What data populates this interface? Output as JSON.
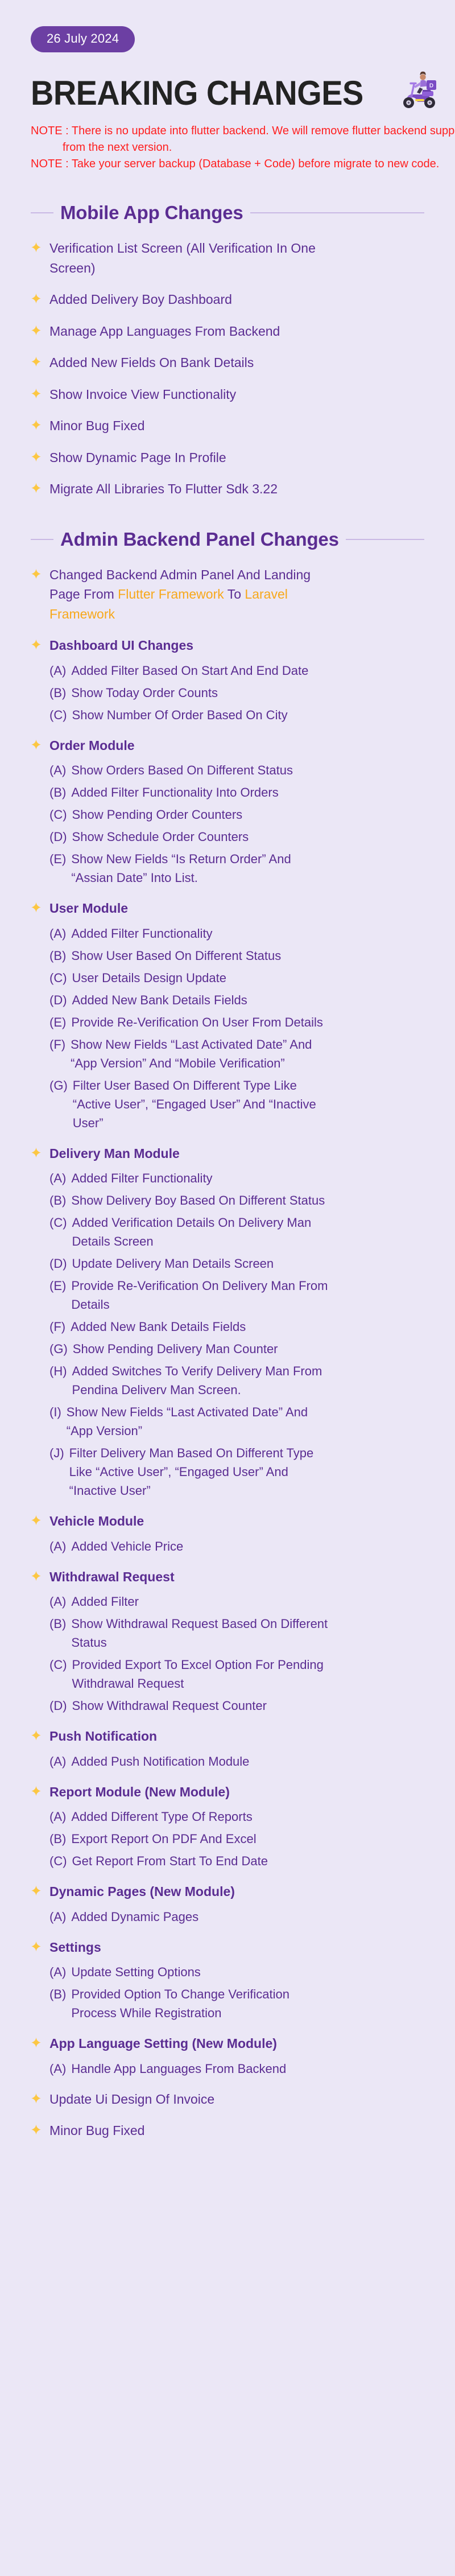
{
  "header": {
    "date_badge": "26 July 2024",
    "title": "BREAKING CHANGES",
    "scooter_icon": "delivery-scooter-icon",
    "notes": [
      "NOTE : There is no update into flutter backend. We will remove flutter backend support",
      "from the next version.",
      "NOTE : Take your server backup (Database + Code) before migrate to new code."
    ]
  },
  "colors": {
    "background": "#ebe7f6",
    "purple": "#5b2d92",
    "badge_purple": "#6c3fa3",
    "note_red": "#ff1f1f",
    "highlight_amber": "#f7a81b",
    "star_yellow": "#fcc743",
    "title_black": "#232323",
    "rule_purple": "#c9b9e4"
  },
  "sections": [
    {
      "title": "Mobile App Changes",
      "items": [
        {
          "text": "Verification List Screen (All Verification In One Screen)"
        },
        {
          "text": "Added Delivery Boy Dashboard"
        },
        {
          "text": "Manage App Languages From Backend"
        },
        {
          "text": "Added New Fields On Bank Details"
        },
        {
          "text": "Show Invoice View Functionality"
        },
        {
          "text": "Minor Bug Fixed"
        },
        {
          "text": "Show Dynamic Page In Profile"
        },
        {
          "text": "Migrate All Libraries To Flutter Sdk 3.22"
        }
      ]
    },
    {
      "title": "Admin Backend Panel Changes",
      "items": [
        {
          "rich": [
            {
              "t": "Changed Backend Admin Panel And Landing Page From ",
              "hl": false
            },
            {
              "t": "Flutter Framework",
              "hl": true
            },
            {
              "t": " To ",
              "hl": false
            },
            {
              "t": "Laravel Framework",
              "hl": true
            }
          ]
        },
        {
          "text": "Dashboard UI Changes",
          "bold": true,
          "subs": [
            {
              "letter": "(A)",
              "text": "Added Filter Based On Start And End Date"
            },
            {
              "letter": "(B)",
              "text": "Show Today Order Counts"
            },
            {
              "letter": "(C)",
              "text": "Show Number Of Order Based On City"
            }
          ]
        },
        {
          "text": "Order Module",
          "bold": true,
          "subs": [
            {
              "letter": "(A)",
              "text": "Show Orders Based On Different Status"
            },
            {
              "letter": "(B)",
              "text": "Added Filter Functionality Into Orders"
            },
            {
              "letter": "(C)",
              "text": "Show Pending Order Counters"
            },
            {
              "letter": "(D)",
              "text": "Show Schedule Order Counters"
            },
            {
              "letter": "(E)",
              "text": "Show New Fields “Is Return Order” And “Assian Date” Into List."
            }
          ]
        },
        {
          "text": "User Module",
          "bold": true,
          "subs": [
            {
              "letter": "(A)",
              "text": "Added Filter Functionality"
            },
            {
              "letter": "(B)",
              "text": "Show User Based On Different Status"
            },
            {
              "letter": "(C)",
              "text": "User Details Design Update"
            },
            {
              "letter": "(D)",
              "text": "Added New Bank Details Fields"
            },
            {
              "letter": "(E)",
              "text": "Provide Re-Verification On User From Details"
            },
            {
              "letter": "(F)",
              "text": "Show New Fields “Last Activated Date” And “App Version” And “Mobile Verification”"
            },
            {
              "letter": "(G)",
              "text": "Filter User Based On Different Type Like “Active User”, “Engaged User” And “Inactive User”"
            }
          ]
        },
        {
          "text": "Delivery Man Module",
          "bold": true,
          "subs": [
            {
              "letter": "(A)",
              "text": "Added Filter Functionality"
            },
            {
              "letter": "(B)",
              "text": "Show Delivery Boy Based On Different Status"
            },
            {
              "letter": "(C)",
              "text": "Added Verification Details On Delivery Man Details Screen"
            },
            {
              "letter": "(D)",
              "text": "Update Delivery Man Details Screen"
            },
            {
              "letter": "(E)",
              "text": "Provide Re-Verification On Delivery Man From Details"
            },
            {
              "letter": "(F)",
              "text": "Added New Bank Details Fields"
            },
            {
              "letter": "(G)",
              "text": "Show Pending Delivery Man Counter"
            },
            {
              "letter": "(H)",
              "text": "Added Switches To Verify Delivery Man From Pendina Deliverv Man Screen."
            },
            {
              "letter": "(I)",
              "text": "Show New Fields “Last Activated Date” And “App Version”"
            },
            {
              "letter": "(J)",
              "text": "Filter Delivery Man  Based On Different Type Like “Active User”, “Engaged User” And “Inactive User”"
            }
          ]
        },
        {
          "text": "Vehicle Module",
          "bold": true,
          "subs": [
            {
              "letter": "(A)",
              "text": "Added Vehicle Price"
            }
          ]
        },
        {
          "text": "Withdrawal Request",
          "bold": true,
          "subs": [
            {
              "letter": "(A)",
              "text": "Added Filter"
            },
            {
              "letter": "(B)",
              "text": "Show Withdrawal Request Based On Different Status"
            },
            {
              "letter": "(C)",
              "text": "Provided Export To Excel Option For Pending Withdrawal Request"
            },
            {
              "letter": "(D)",
              "text": "Show Withdrawal Request Counter"
            }
          ]
        },
        {
          "text": "Push Notification",
          "bold": true,
          "subs": [
            {
              "letter": "(A)",
              "text": "Added Push Notification Module"
            }
          ]
        },
        {
          "text": "Report Module (New Module)",
          "bold": true,
          "subs": [
            {
              "letter": "(A)",
              "text": "Added Different Type Of Reports"
            },
            {
              "letter": "(B)",
              "text": "Export Report On PDF And Excel"
            },
            {
              "letter": "(C)",
              "text": "Get Report From Start To End Date"
            }
          ]
        },
        {
          "text": "Dynamic Pages (New Module)",
          "bold": true,
          "subs": [
            {
              "letter": "(A)",
              "text": "Added Dynamic Pages"
            }
          ]
        },
        {
          "text": "Settings",
          "bold": true,
          "subs": [
            {
              "letter": "(A)",
              "text": "Update Setting Options"
            },
            {
              "letter": "(B)",
              "text": "Provided Option To Change Verification Process While Registration"
            }
          ]
        },
        {
          "text": "App Language Setting (New Module)",
          "bold": true,
          "subs": [
            {
              "letter": "(A)",
              "text": "Handle App Languages From Backend"
            }
          ]
        },
        {
          "text": "Update Ui Design Of Invoice"
        },
        {
          "text": "Minor Bug Fixed"
        }
      ]
    }
  ]
}
